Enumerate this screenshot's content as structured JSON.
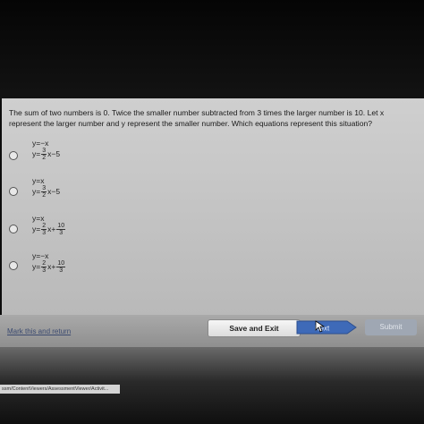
{
  "question": "The sum of two numbers is 0. Twice the smaller number subtracted from 3 times the larger number is 10. Let x represent the larger number and y represent the smaller number. Which equations represent this situation?",
  "options": [
    {
      "line1": "y=−x",
      "line2_prefix": "y=",
      "frac_num": "3",
      "frac_den": "2",
      "line2_suffix": "x−5",
      "extra_frac": false
    },
    {
      "line1": "y=x",
      "line2_prefix": "y=",
      "frac_num": "3",
      "frac_den": "2",
      "line2_suffix": "x−5",
      "extra_frac": false
    },
    {
      "line1": "y=x",
      "line2_prefix": "y=",
      "frac_num": "2",
      "frac_den": "3",
      "line2_suffix": "x+",
      "extra_num": "10",
      "extra_den": "3",
      "extra_frac": true
    },
    {
      "line1": "y=−x",
      "line2_prefix": "y=",
      "frac_num": "2",
      "frac_den": "3",
      "line2_suffix": "x+",
      "extra_num": "10",
      "extra_den": "3",
      "extra_frac": true
    }
  ],
  "footer": {
    "mark_link": "Mark this and return",
    "save_label": "Save and Exit",
    "next_label": "Next",
    "submit_label": "Submit"
  },
  "status_url": "ssm/ContentViewers/AssessmentViewer/Activit...",
  "colors": {
    "panel": "#c4c4c4",
    "next_button": "#3e6ab8",
    "submit_button": "#9fa7b3"
  }
}
